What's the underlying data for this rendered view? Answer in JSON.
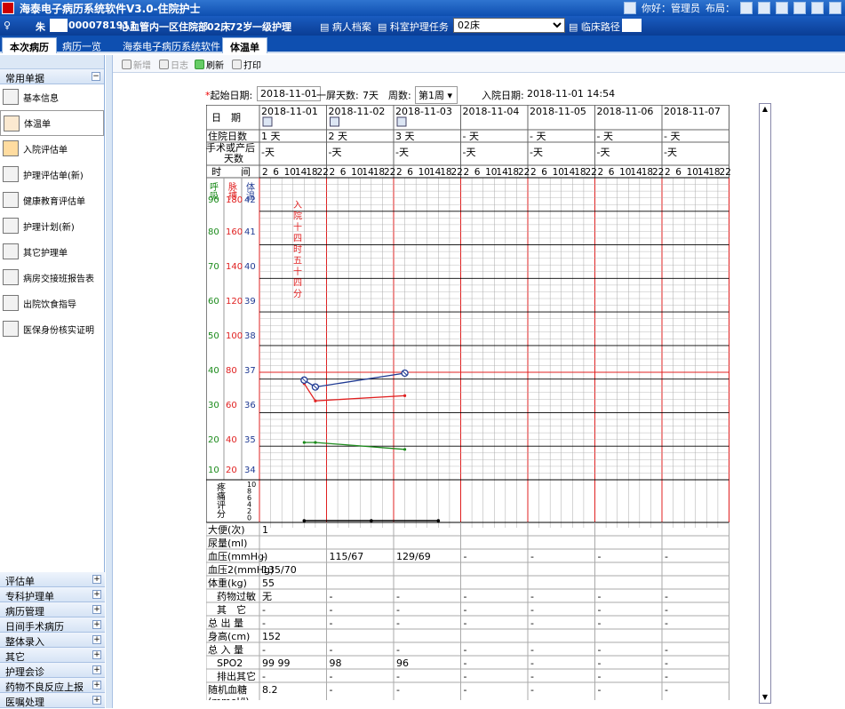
{
  "app": {
    "title": "海泰电子病历系统软件V3.0-住院护士",
    "user_label": "你好：管理员",
    "layout_label": "布局：",
    "accent": "#0e4fb0"
  },
  "patient": {
    "name": "朱",
    "id": "0000781911",
    "dept": "心血管内一区住院部",
    "bed": "02床",
    "age": "72岁",
    "level": "一级护理",
    "btn_record": "病人档案",
    "btn_task": "科室护理任务",
    "bed_select": "02床",
    "btn_path": "临床路径"
  },
  "tabs": [
    "本次病历",
    "病历一览",
    "海泰电子病历系统软件",
    "体温单"
  ],
  "sidebar": {
    "group": "常用单据",
    "items": [
      "基本信息",
      "体温单",
      "入院评估单",
      "护理评估单(新)",
      "健康教育评估单",
      "护理计划(新)",
      "其它护理单",
      "病房交接班报告表",
      "出院饮食指导",
      "医保身份核实证明"
    ],
    "bottom": [
      "评估单",
      "专科护理单",
      "病历管理",
      "日间手术病历",
      "整体录入",
      "其它",
      "护理会诊",
      "药物不良反应上报",
      "医嘱处理"
    ]
  },
  "toolbar": {
    "new": "新增",
    "log": "日志",
    "refresh": "刷新",
    "print": "打印"
  },
  "header": {
    "start_label": "起始日期:",
    "start_date": "2018-11-01",
    "days_label": "一屏天数:",
    "days": "7天",
    "week_label": "周数:",
    "week": "第1周",
    "admit_label": "入院日期:",
    "admit": "2018-11-01 14:54"
  },
  "chart_data": {
    "type": "line",
    "dates": [
      "2018-11-01",
      "2018-11-02",
      "2018-11-03",
      "2018-11-04",
      "2018-11-05",
      "2018-11-06",
      "2018-11-07"
    ],
    "row_labels": {
      "date": "日　期",
      "hosp_days": "住院日数",
      "op_days": "手术或产后天数",
      "time": "时　　间"
    },
    "hosp_days": [
      "1 天",
      "2 天",
      "3 天",
      "- 天",
      "- 天",
      "- 天",
      "- 天"
    ],
    "op_days": [
      "-天",
      "-天",
      "-天",
      "-天",
      "-天",
      "-天",
      "-天"
    ],
    "hours": [
      "2",
      "6",
      "10",
      "14",
      "18",
      "22"
    ],
    "axis_titles": {
      "resp": "呼吸",
      "pulse": "脉搏",
      "temp": "体温"
    },
    "resp_ticks": [
      "90",
      "80",
      "70",
      "60",
      "50",
      "40",
      "30",
      "20",
      "10"
    ],
    "pulse_ticks": [
      "180",
      "160",
      "140",
      "120",
      "100",
      "80",
      "60",
      "40",
      "20"
    ],
    "temp_ticks": [
      "42",
      "41",
      "40",
      "39",
      "38",
      "37",
      "36",
      "35",
      "34"
    ],
    "admission_note": "入院十四时五十四分",
    "temp_series": [
      {
        "t": "2018-11-01 14",
        "v": 36.8
      },
      {
        "t": "2018-11-01 18",
        "v": 36.6
      },
      {
        "t": "2018-11-03 2",
        "v": 37.0
      }
    ],
    "pulse_series": [
      {
        "t": "2018-11-01 14",
        "v": 74
      },
      {
        "t": "2018-11-01 18",
        "v": 64
      },
      {
        "t": "2018-11-03 2",
        "v": 67
      }
    ],
    "resp_series": [
      {
        "t": "2018-11-01 14",
        "v": 20
      },
      {
        "t": "2018-11-01 18",
        "v": 20
      },
      {
        "t": "2018-11-03 2",
        "v": 18
      }
    ],
    "pain_label": "疼痛评分",
    "pain_ticks": [
      "10",
      "8",
      "6",
      "4",
      "2",
      "0"
    ],
    "pain_series": [
      {
        "t": "2018-11-01 14",
        "v": 0
      },
      {
        "t": "2018-11-02 14",
        "v": 0
      },
      {
        "t": "2018-11-03 14",
        "v": 0
      }
    ],
    "colors": {
      "temp": "#1f3a93",
      "pulse": "#e02020",
      "resp": "#1a8a1a",
      "grid": "#999",
      "redline": "#e02020"
    },
    "table_rows": [
      {
        "label": "大便(次)",
        "vals": [
          "1",
          "",
          "",
          "",
          "",
          "",
          ""
        ]
      },
      {
        "label": "尿量(ml)",
        "vals": [
          "",
          "",
          "",
          "",
          "",
          "",
          ""
        ]
      },
      {
        "label": "血压(mmHg)",
        "vals": [
          "-",
          "115/67",
          "129/69",
          "-",
          "-",
          "-",
          "-"
        ]
      },
      {
        "label": "血压2(mmHg)",
        "vals": [
          "135/70",
          "",
          "",
          "",
          "",
          "",
          ""
        ]
      },
      {
        "label": "体重(kg)",
        "vals": [
          "55",
          "",
          "",
          "",
          "",
          "",
          ""
        ]
      },
      {
        "label": "药物过敏",
        "vals": [
          "无",
          "-",
          "-",
          "-",
          "-",
          "-",
          "-"
        ]
      },
      {
        "label": "其　它",
        "vals": [
          "-",
          "-",
          "-",
          "-",
          "-",
          "-",
          "-"
        ]
      },
      {
        "label": "总 出 量",
        "vals": [
          "-",
          "-",
          "-",
          "-",
          "-",
          "-",
          "-"
        ]
      },
      {
        "label": "身高(cm)",
        "vals": [
          "152",
          "",
          "",
          "",
          "",
          "",
          ""
        ]
      },
      {
        "label": "总 入 量",
        "vals": [
          "-",
          "-",
          "-",
          "-",
          "-",
          "-",
          "-"
        ]
      },
      {
        "label": "SPO2",
        "vals": [
          "99 99",
          "98",
          "96",
          "-",
          "-",
          "-",
          "-"
        ]
      },
      {
        "label": "排出其它",
        "vals": [
          "-",
          "-",
          "-",
          "-",
          "-",
          "-",
          "-"
        ]
      },
      {
        "label": "随机血糖(mmol/l)",
        "vals": [
          "8.2",
          "-",
          "-",
          "-",
          "-",
          "-",
          "-"
        ]
      }
    ]
  }
}
